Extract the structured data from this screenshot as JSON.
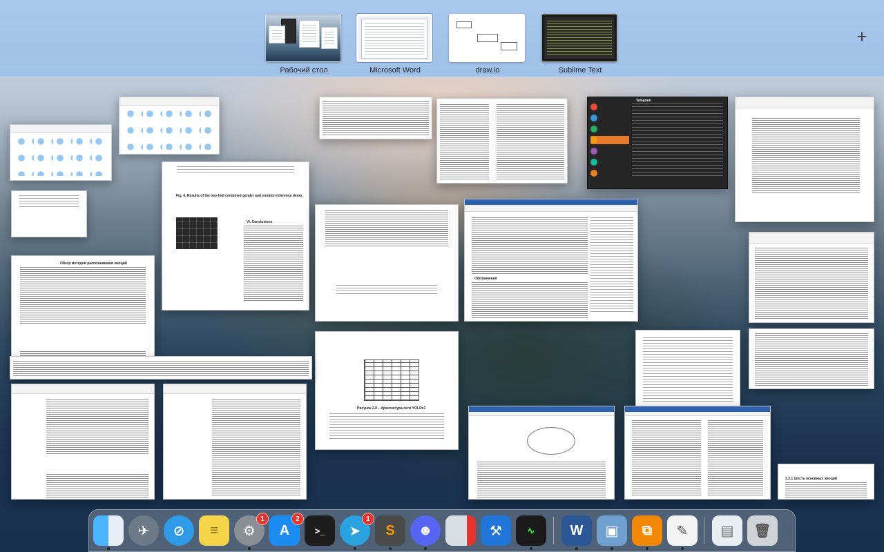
{
  "spaces": [
    {
      "label": "Рабочий стол",
      "active": false
    },
    {
      "label": "Microsoft Word",
      "active": true
    },
    {
      "label": "draw.io",
      "active": false
    },
    {
      "label": "Sublime Text",
      "active": false
    }
  ],
  "add_space_glyph": "+",
  "document_texts": {
    "paper_heading": "Обзор методов распознавания эмоций",
    "paper_caption": "Fig. 4. Results of the two-fold combined gender and emotion inference demo.",
    "section_title": "VI. Conclusions",
    "figure_caption": "Рисунок 2.8 – Архитектура сети YOLOv3",
    "thesis_heading": "3.3.1 Шесть основных эмоций",
    "word_section": "Обозначения",
    "chat_header": "Telegram"
  },
  "dock": {
    "badges": {
      "system_preferences": "1",
      "app_store": "2",
      "telegram": "1"
    },
    "items": [
      {
        "name": "finder-icon",
        "color": "#1f8ff0"
      },
      {
        "name": "launchpad-icon",
        "color": "#6c7a89"
      },
      {
        "name": "safari-icon",
        "color": "#2f9be8"
      },
      {
        "name": "notes-icon",
        "color": "#f6d44a"
      },
      {
        "name": "system-preferences-icon",
        "color": "#8a8f95"
      },
      {
        "name": "app-store-icon",
        "color": "#1c8cf2"
      },
      {
        "name": "terminal-icon",
        "color": "#1d1d1d"
      },
      {
        "name": "telegram-icon",
        "color": "#2aa3e0"
      },
      {
        "name": "sublime-text-icon",
        "color": "#4a4a4a"
      },
      {
        "name": "discord-icon",
        "color": "#5865f2"
      },
      {
        "name": "parallels-icon",
        "color": "#d9dee4"
      },
      {
        "name": "xcode-icon",
        "color": "#1f75d8"
      },
      {
        "name": "activity-monitor-icon",
        "color": "#1a1a1a"
      },
      {
        "name": "word-icon",
        "color": "#2b5797"
      },
      {
        "name": "preview-icon",
        "color": "#6fa0d0"
      },
      {
        "name": "drawio-icon",
        "color": "#f08705"
      },
      {
        "name": "textedit-icon",
        "color": "#f4f4f4"
      },
      {
        "name": "downloads-stack-icon",
        "color": "#e9eef3"
      },
      {
        "name": "trash-icon",
        "color": "#d0d4d8"
      }
    ]
  }
}
